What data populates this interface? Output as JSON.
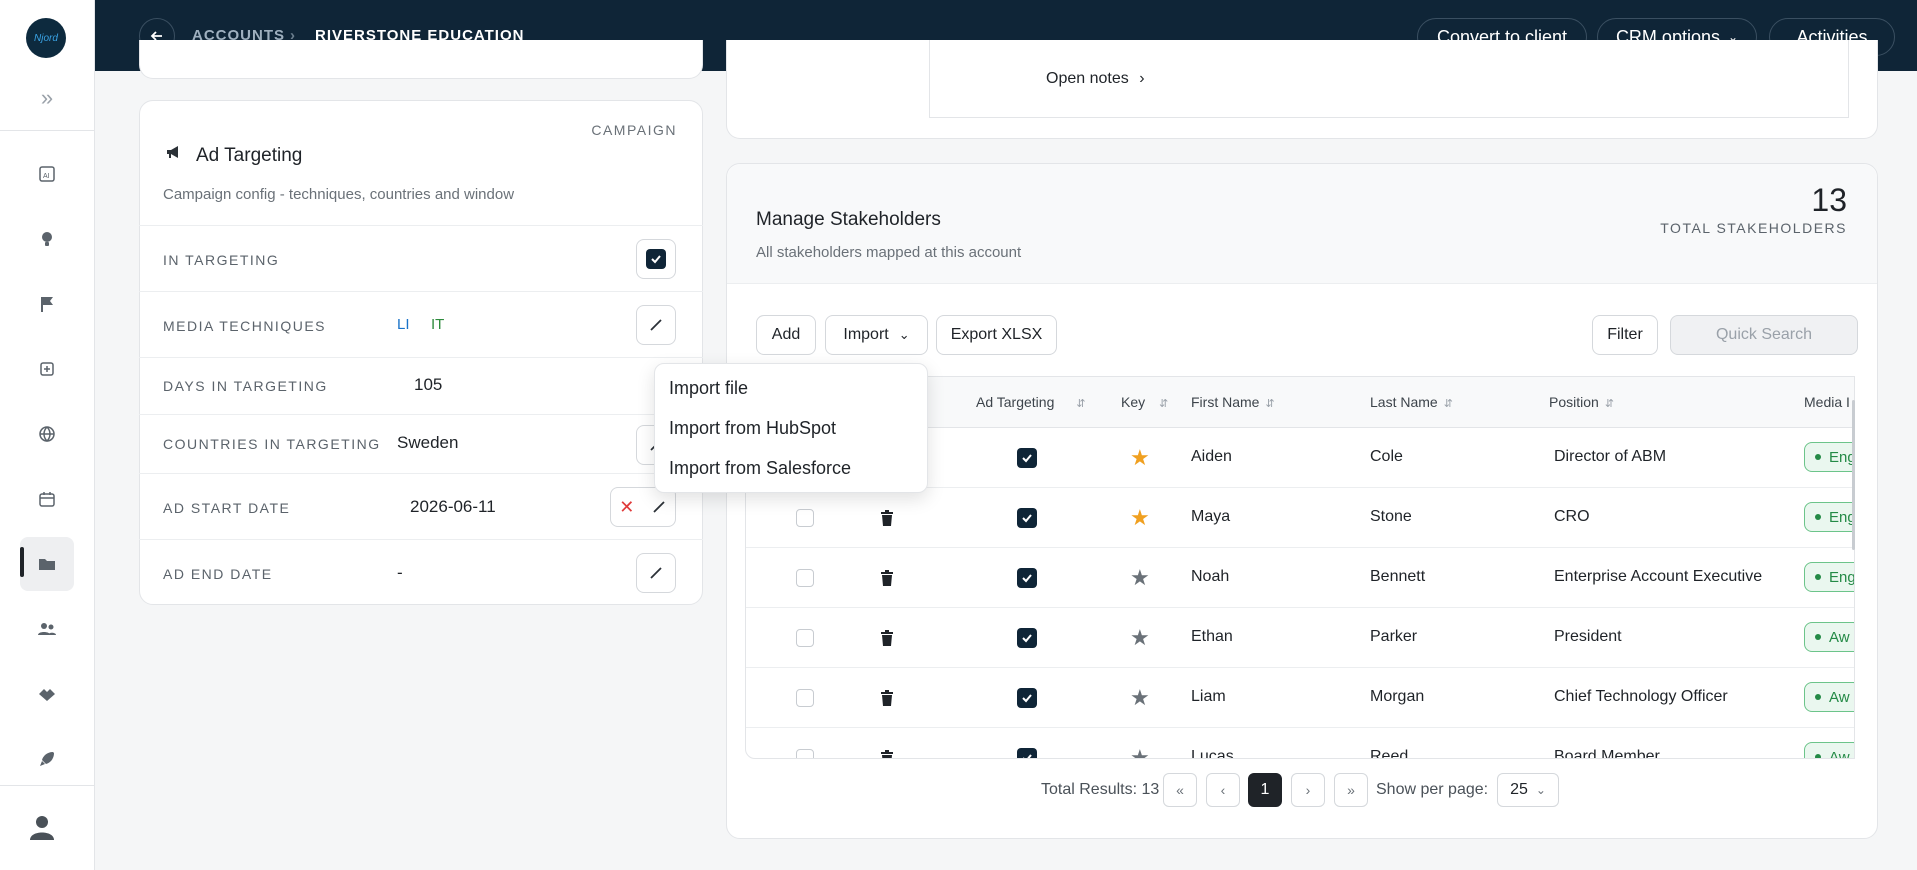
{
  "app": {
    "logo_text": "Njord"
  },
  "header": {
    "breadcrumb": [
      "ACCOUNTS",
      "RIVERSTONE EDUCATION"
    ],
    "separator": "›",
    "buttons": {
      "convert": "Convert to client",
      "crm": "CRM options",
      "activities": "Activities"
    }
  },
  "ad_targeting": {
    "tag": "CAMPAIGN",
    "title": "Ad Targeting",
    "subtitle": "Campaign config - techniques, countries and window",
    "rows": {
      "in_targeting": {
        "label": "IN TARGETING",
        "checked": true
      },
      "media_techniques": {
        "label": "MEDIA TECHNIQUES",
        "values": [
          "LI",
          "IT"
        ]
      },
      "days": {
        "label": "DAYS IN TARGETING",
        "value": "105"
      },
      "countries": {
        "label": "COUNTRIES IN TARGETING",
        "value": "Sweden"
      },
      "start": {
        "label": "AD START DATE",
        "value": "2026-06-11"
      },
      "end": {
        "label": "AD END DATE",
        "value": "-"
      }
    }
  },
  "notes": {
    "open_notes": "Open notes"
  },
  "stakeholders": {
    "title": "Manage Stakeholders",
    "subtitle": "All stakeholders mapped at this account",
    "count": "13",
    "count_label": "TOTAL STAKEHOLDERS",
    "toolbar": {
      "add": "Add",
      "import": "Import",
      "export": "Export XLSX",
      "filter": "Filter",
      "search_placeholder": "Quick Search"
    },
    "columns": [
      "Ad Targeting",
      "Key",
      "First Name",
      "Last Name",
      "Position",
      "Media I"
    ],
    "rows": [
      {
        "first": "Aiden",
        "last": "Cole",
        "position": "Director of ABM",
        "key": true,
        "status": "Eng"
      },
      {
        "first": "Maya",
        "last": "Stone",
        "position": "CRO",
        "key": true,
        "status": "Eng"
      },
      {
        "first": "Noah",
        "last": "Bennett",
        "position": "Enterprise Account Executive",
        "key": false,
        "status": "Eng"
      },
      {
        "first": "Ethan",
        "last": "Parker",
        "position": "President",
        "key": false,
        "status": "Aw"
      },
      {
        "first": "Liam",
        "last": "Morgan",
        "position": "Chief Technology Officer",
        "key": false,
        "status": "Aw"
      },
      {
        "first": "Lucas",
        "last": "Reed",
        "position": "Board Member",
        "key": false,
        "status": "Aw"
      }
    ],
    "pagination": {
      "total": "Total Results: 13",
      "page": "1",
      "per_page_label": "Show per page:",
      "per_page": "25"
    }
  },
  "import_menu": [
    "Import file",
    "Import from HubSpot",
    "Import from Salesforce"
  ],
  "colors": {
    "nav": "#0f2537",
    "key_star": "#f0a020",
    "star_off": "#6a7178",
    "status_green": "#248a46"
  }
}
